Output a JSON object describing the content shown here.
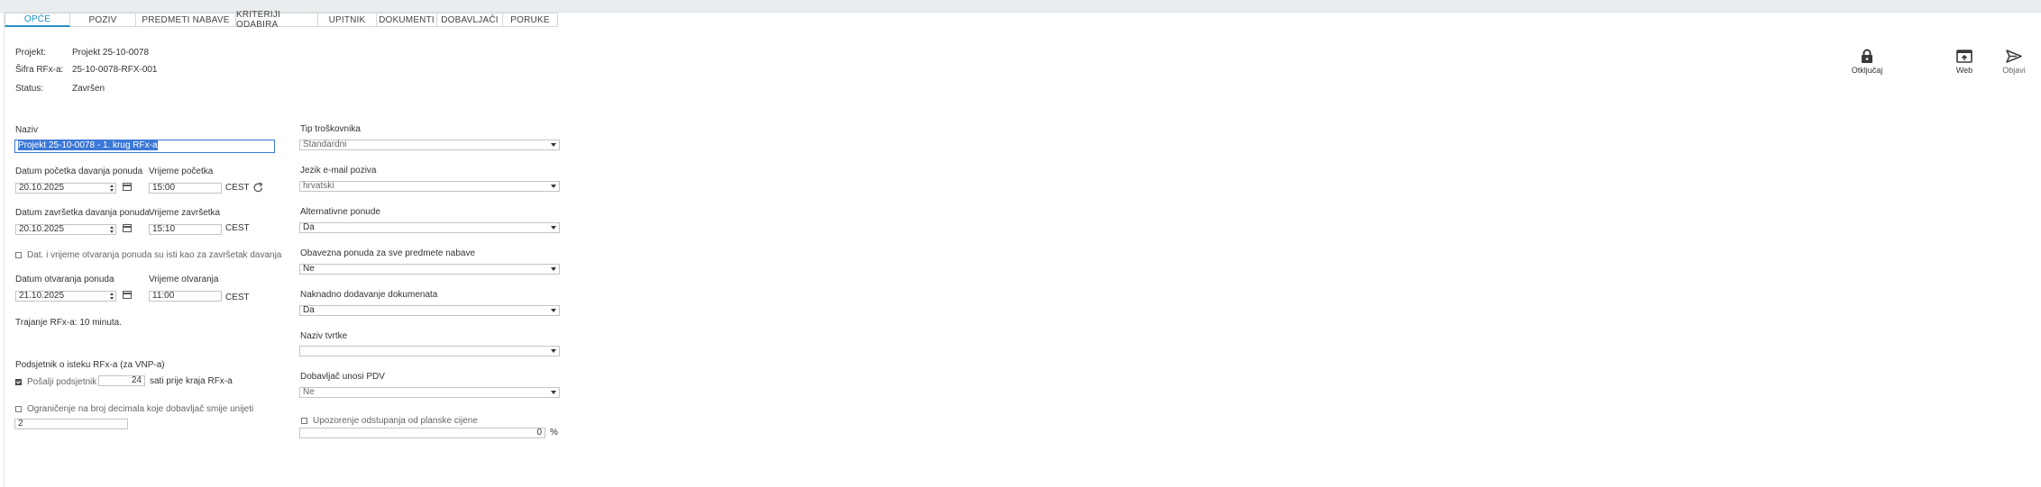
{
  "tabs": [
    {
      "label": "OPĆE",
      "active": true
    },
    {
      "label": "POZIV"
    },
    {
      "label": "PREDMETI NABAVE"
    },
    {
      "label": "KRITERIJI ODABIRA"
    },
    {
      "label": "UPITNIK"
    },
    {
      "label": "DOKUMENTI"
    },
    {
      "label": "DOBAVLJAČI"
    },
    {
      "label": "PORUKE"
    }
  ],
  "info": {
    "projekt_label": "Projekt:",
    "projekt_value": "Projekt 25-10-0078",
    "sifra_label": "Šifra RFx-a:",
    "sifra_value": "25-10-0078-RFX-001",
    "status_label": "Status:",
    "status_value": "Završen"
  },
  "toolbar": {
    "unlock_label": "Otključaj",
    "web_label": "Web",
    "publish_label": "Objavi"
  },
  "form": {
    "naziv_label": "Naziv",
    "naziv_value": "Projekt 25-10-0078 - 1. krug RFx-a",
    "start_date_label": "Datum početka davanja ponuda",
    "start_date_value": "20.10.2025",
    "start_time_label": "Vrijeme početka",
    "start_time_value": "15:00",
    "tz": "CEST",
    "end_date_label": "Datum završetka davanja ponuda",
    "end_date_value": "20.10.2025",
    "end_time_label": "Vrijeme završetka",
    "end_time_value": "15:10",
    "same_as_end_label": "Dat. i vrijeme otvaranja ponuda su isti kao za završetak davanja",
    "same_as_end_checked": false,
    "open_date_label": "Datum otvaranja ponuda",
    "open_date_value": "21.10.2025",
    "open_time_label": "Vrijeme otvaranja",
    "open_time_value": "11:00",
    "duration_text": "Trajanje RFx-a: 10 minuta.",
    "reminder_title": "Podsjetnik o isteku RFx-a (za VNP-a)",
    "send_reminder_label": "Pošalji podsjetnik",
    "send_reminder_checked": true,
    "reminder_hours": "24",
    "reminder_suffix": "sati prije kraja RFx-a",
    "decimals_label": "Ograničenje na broj decimala koje dobavljač smije unijeti",
    "decimals_checked": false,
    "decimals_value": "2"
  },
  "right": {
    "tip_label": "Tip troškovnika",
    "tip_value": "Standardni",
    "jezik_label": "Jezik e-mail poziva",
    "jezik_value": "hrvatski",
    "alt_label": "Alternativne ponude",
    "alt_value": "Da",
    "obavezna_label": "Obavezna ponuda za sve predmete nabave",
    "obavezna_value": "Ne",
    "naknadno_label": "Naknadno dodavanje dokumenata",
    "naknadno_value": "Da",
    "tvrtka_label": "Naziv tvrtke",
    "tvrtka_value": "",
    "pdv_label": "Dobavljač unosi PDV",
    "pdv_value": "Ne",
    "upozorenje_label": "Upozorenje odstupanja od planske cijene",
    "upozorenje_checked": false,
    "upozorenje_value": "0",
    "percent": "%"
  },
  "colors": {
    "accent": "#1a8ec9",
    "selection": "#3b78d8"
  }
}
